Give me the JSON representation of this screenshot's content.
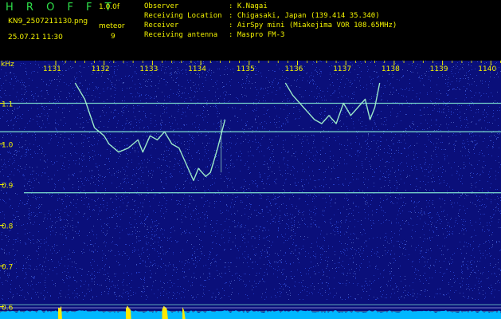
{
  "header": {
    "program": "H R O F F T",
    "version": "1.0.0f",
    "filename": "KN9_2507211130.png",
    "meteor_label": "meteor",
    "meteor_count": "9",
    "datetime": "25.07.21 11:30",
    "info": [
      {
        "label": "Observer",
        "value": ": K.Nagai"
      },
      {
        "label": "Receiving Location",
        "value": ": Chigasaki, Japan (139.414 35.340)"
      },
      {
        "label": "Receiver",
        "value": ": AirSpy mini (Miakejima VOR 108.65MHz)"
      },
      {
        "label": "Receiving antenna",
        "value": ": Maspro FM-3"
      }
    ]
  },
  "colors": {
    "background": "#0a0f7a",
    "noise": "#3b63ff",
    "trace": "#9be8c8",
    "carrier": "#7fe3d0",
    "baseline_fill": "#00b7ff",
    "burst": "#ffe800",
    "label_yellow": "#f2f200",
    "label_green": "#2ee24a"
  },
  "chart_data": {
    "type": "spectrogram",
    "y_unit": "kHz",
    "x_ticks": [
      "1131",
      "1132",
      "1133",
      "1134",
      "1135",
      "1136",
      "1137",
      "1138",
      "1139",
      "1140"
    ],
    "y_ticks": [
      "1.1",
      "1.0",
      "0.9",
      "0.8",
      "0.7",
      "0.6"
    ],
    "y_range": [
      0.6,
      1.15
    ],
    "x_range": [
      1131,
      1140
    ],
    "carriers_khz": [
      1.1,
      1.03,
      0.88,
      0.605
    ],
    "trace_1": {
      "x": [
        1131.4,
        1131.6,
        1131.8,
        1132.0,
        1132.1,
        1132.3,
        1132.5,
        1132.7,
        1132.8,
        1132.95,
        1133.1,
        1133.25,
        1133.4,
        1133.55,
        1133.7,
        1133.85,
        1133.95,
        1134.1,
        1134.2,
        1134.35,
        1134.5
      ],
      "y": [
        1.15,
        1.11,
        1.04,
        1.02,
        1.0,
        0.98,
        0.99,
        1.01,
        0.98,
        1.02,
        1.01,
        1.03,
        1.0,
        0.99,
        0.95,
        0.91,
        0.94,
        0.92,
        0.93,
        0.99,
        1.06
      ]
    },
    "trace_2": {
      "x": [
        1135.75,
        1135.9,
        1136.05,
        1136.2,
        1136.35,
        1136.5,
        1136.65,
        1136.8,
        1136.95,
        1137.1,
        1137.25,
        1137.4,
        1137.5,
        1137.6,
        1137.7
      ],
      "y": [
        1.15,
        1.12,
        1.1,
        1.08,
        1.06,
        1.05,
        1.07,
        1.05,
        1.1,
        1.07,
        1.09,
        1.11,
        1.06,
        1.09,
        1.15
      ]
    },
    "bursts": [
      [
        1131.05,
        1131.13
      ],
      [
        1132.45,
        1132.56
      ],
      [
        1133.2,
        1133.32
      ],
      [
        1133.62,
        1133.68
      ]
    ]
  }
}
